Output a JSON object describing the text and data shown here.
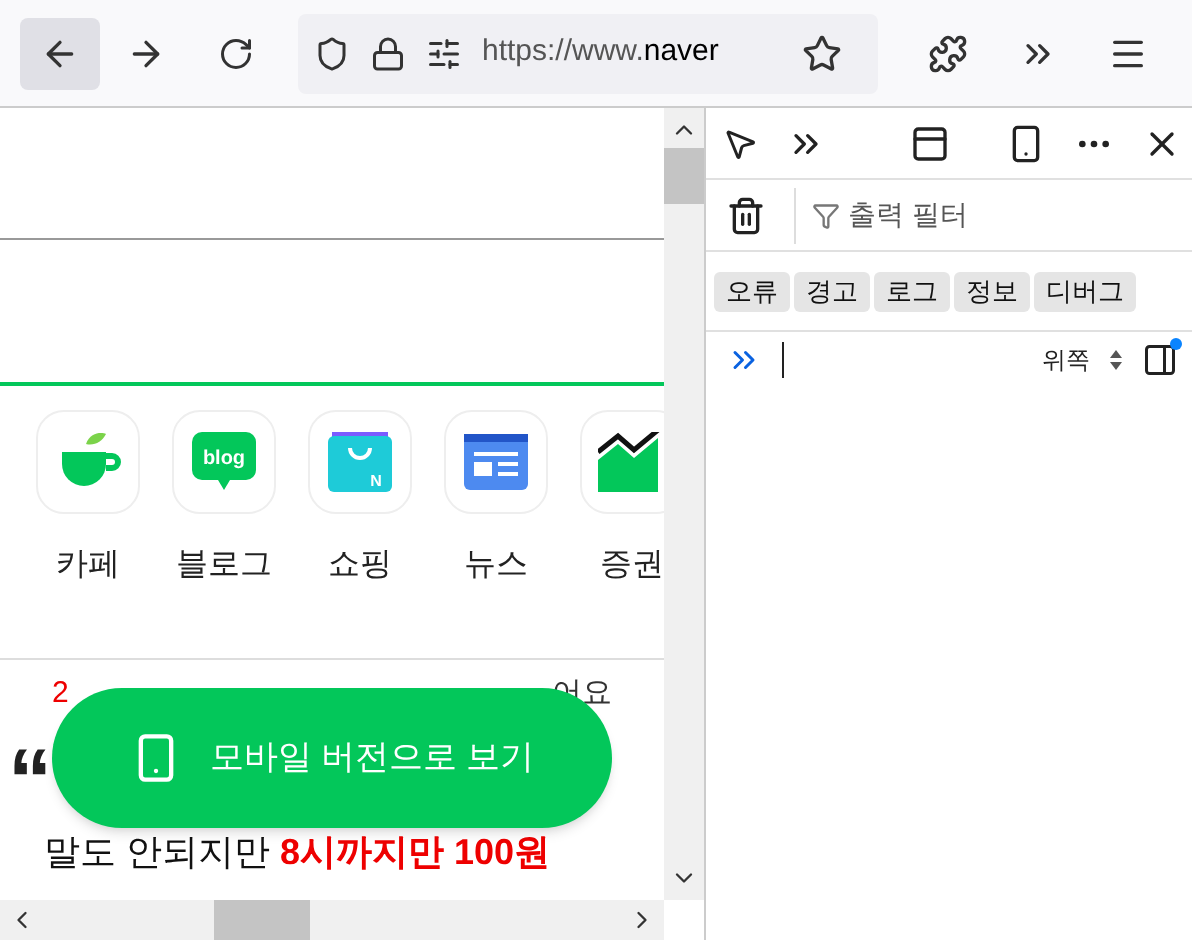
{
  "toolbar": {
    "url_prefix": "https://www.",
    "url_host": "naver"
  },
  "page": {
    "apps": [
      {
        "label": "카페",
        "kind": "cafe"
      },
      {
        "label": "블로그",
        "kind": "blog",
        "icon_text": "blog"
      },
      {
        "label": "쇼핑",
        "kind": "shopping",
        "icon_text": "N"
      },
      {
        "label": "뉴스",
        "kind": "news"
      },
      {
        "label": "증권",
        "kind": "stocks"
      }
    ],
    "headline_number": "2",
    "headline_tail": "어요",
    "quote_mark": "“",
    "subline": "말도 안되지만 **8시까지만 100원**",
    "mobile_button": "모바일 버전으로 보기"
  },
  "devtools": {
    "filter_placeholder": "출력 필터",
    "levels": [
      {
        "label": "오류",
        "selected": true
      },
      {
        "label": "경고",
        "selected": true
      },
      {
        "label": "로그",
        "selected": true
      },
      {
        "label": "정보",
        "selected": true
      },
      {
        "label": "디버그",
        "selected": true
      }
    ],
    "position": "위쪽"
  }
}
